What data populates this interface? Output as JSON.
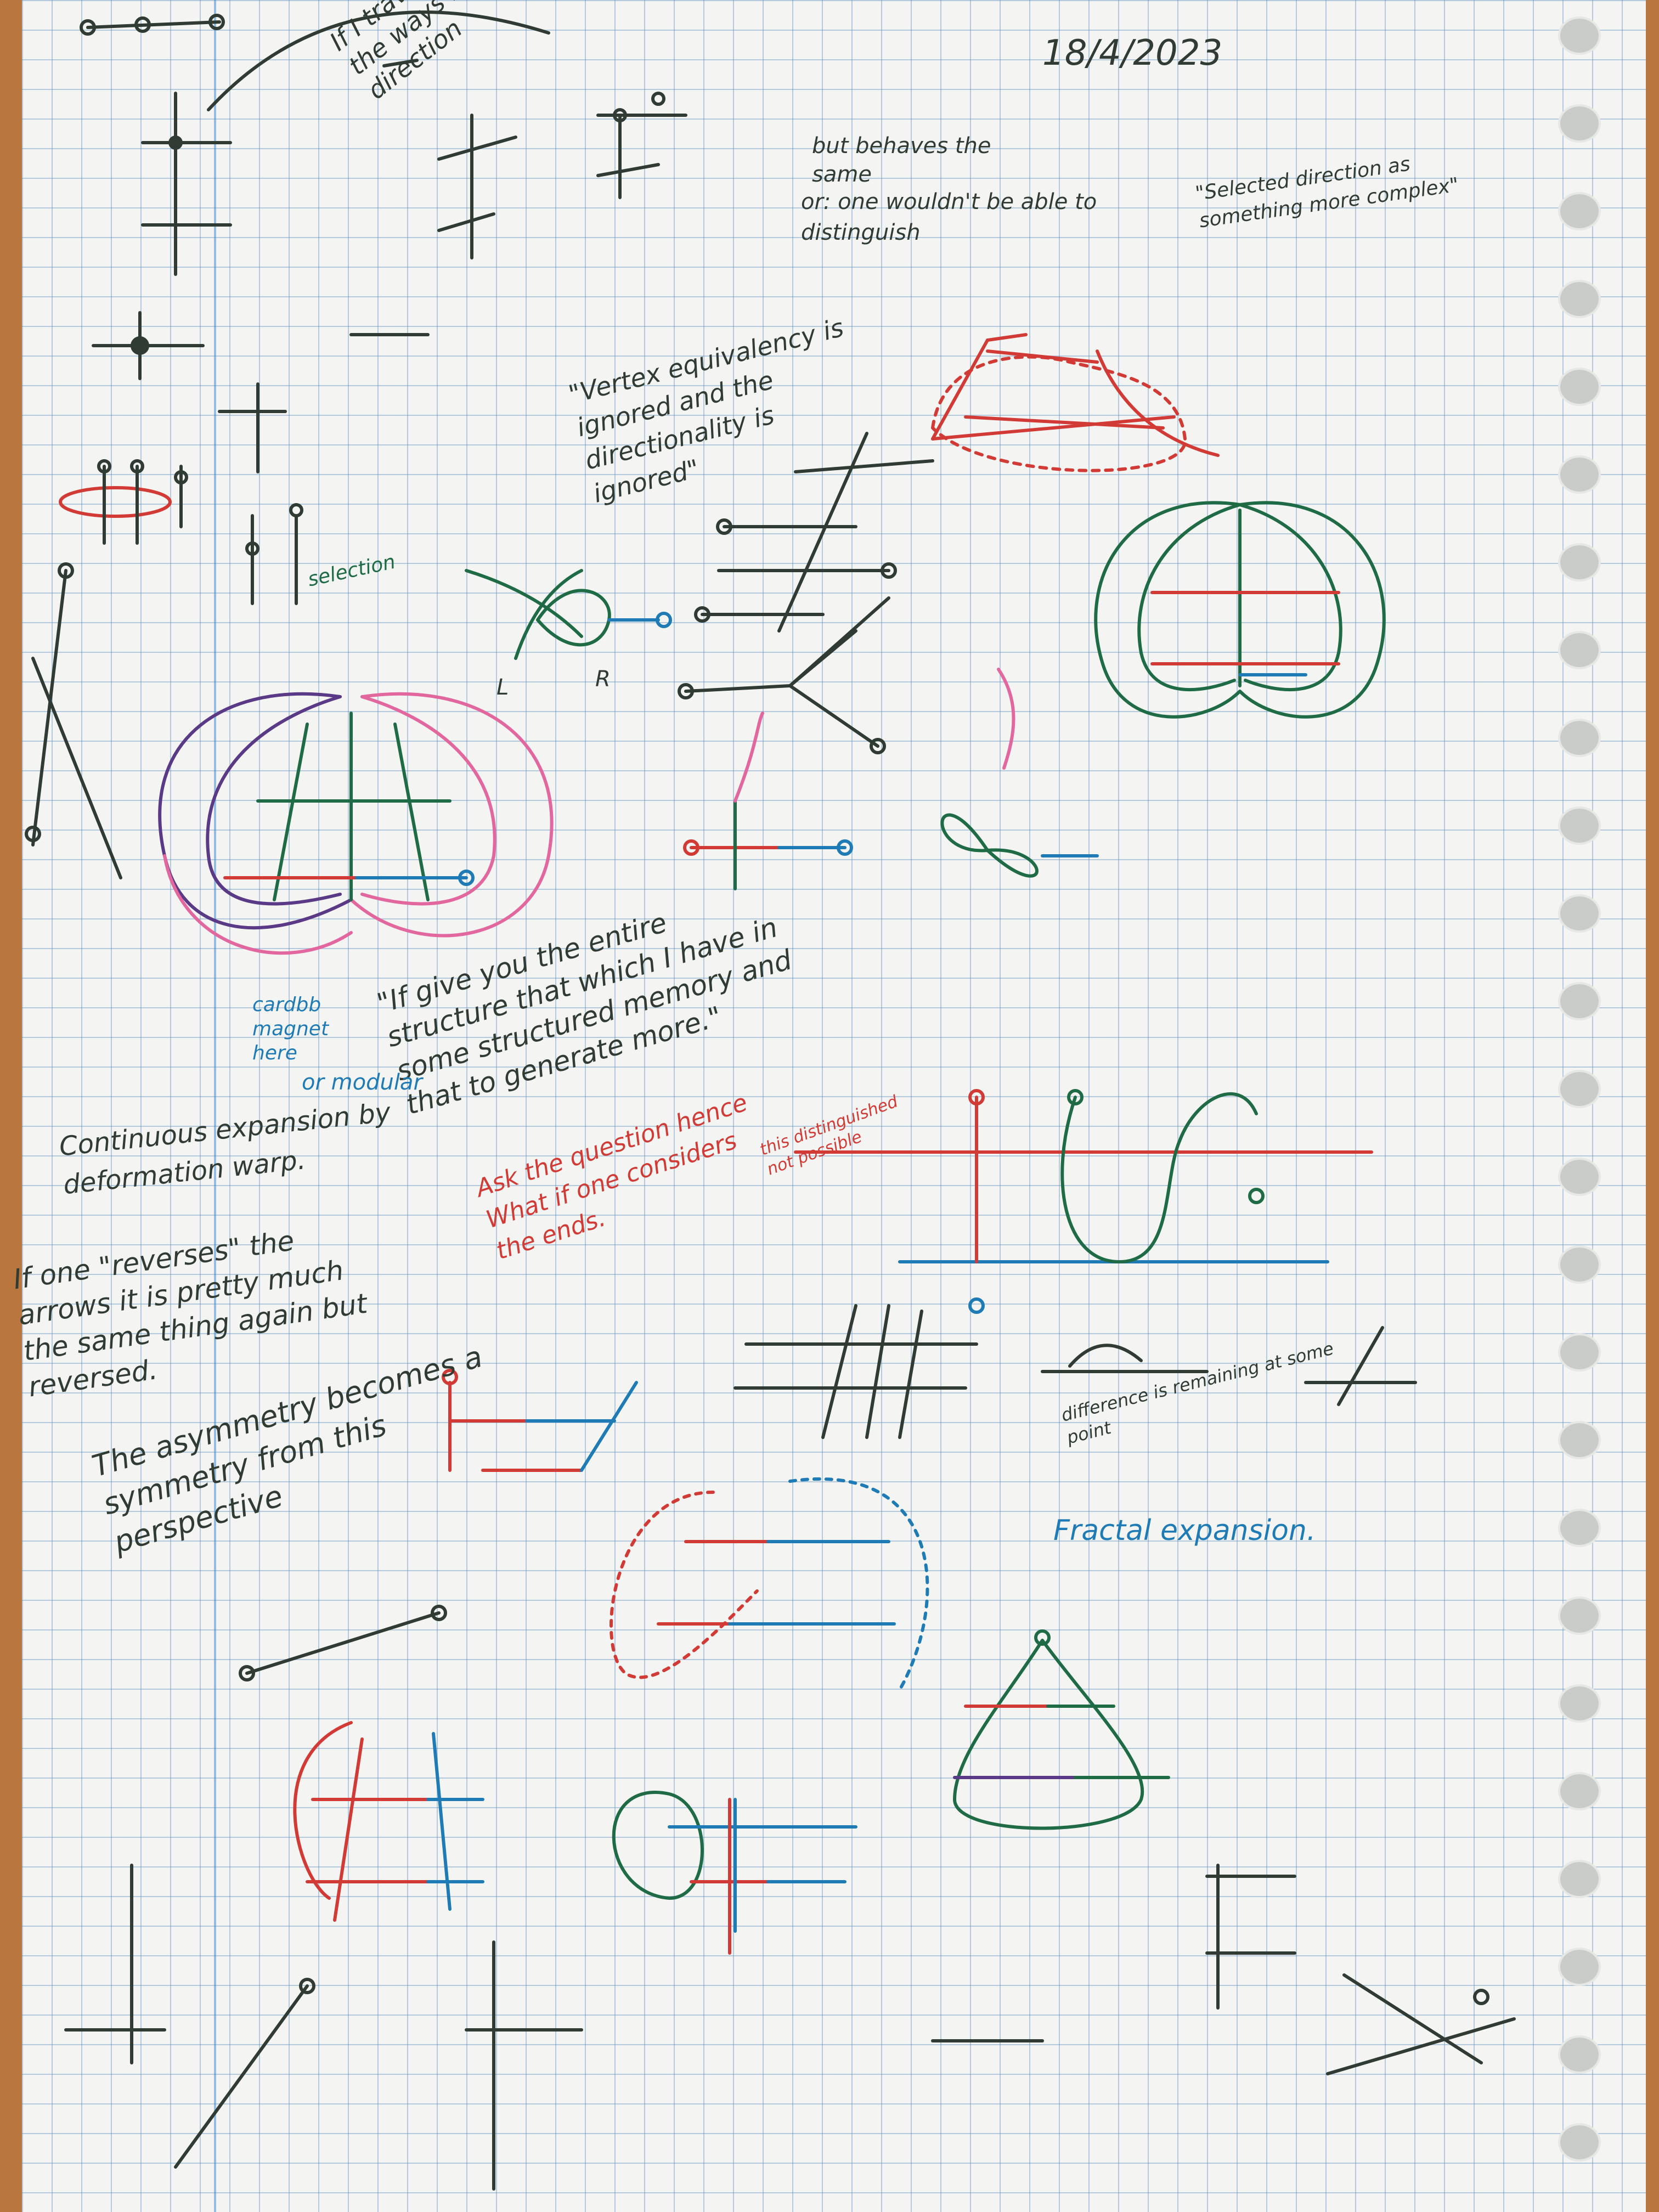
{
  "date": "18/4/2023",
  "notes": {
    "traverse": "If I traverse both the ways it is in direction",
    "behaves": "but behaves the same",
    "distinguish": "or: one wouldn't be able to distinguish",
    "selected_direction": "\"Selected direction as something more complex\"",
    "vertex": "\"Vertex equivalency is ignored and the directionality is ignored\"",
    "selection": "selection",
    "entire_structure": "\"If give you the entire structure that which I have in some structured memory and that to generate more.\"",
    "cardbb": "cardbb magnet here",
    "modular": "or modular",
    "continuous": "Continuous expansion by deformation warp.",
    "ask_question": "Ask the question hence What if one considers the ends.",
    "distinguished": "this distinguished not possible",
    "reverses": "If one \"reverses\" the arrows it is pretty much the same thing again but reversed.",
    "asymmetry": "The asymmetry becomes a symmetry from this perspective",
    "difference": "difference is remaining at some point",
    "fractal": "Fractal expansion.",
    "label_l": "L",
    "label_r": "R"
  },
  "colors": {
    "ink_dark": "#2f3b33",
    "ink_green": "#1f6b45",
    "ink_blue": "#1f7bb5",
    "ink_red": "#d23a35",
    "ink_pink": "#e2679e",
    "ink_purple": "#5a3a86",
    "paper": "#f4f5f2",
    "grid": "#5a8cbe",
    "desk": "#b9763e"
  }
}
